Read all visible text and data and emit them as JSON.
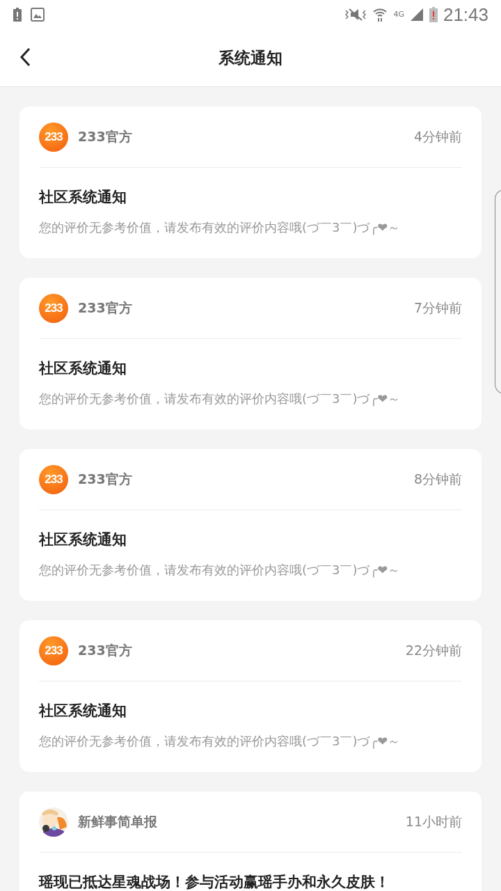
{
  "status_bar": {
    "time": "21:43",
    "network": "4G"
  },
  "header": {
    "title": "系统通知"
  },
  "notifications": [
    {
      "avatar": {
        "kind": "logo",
        "text": "233"
      },
      "sender": "233官方",
      "time": "4分钟前",
      "title": "社区系统通知",
      "body": "您的评价无参考价值，请发布有效的评价内容哦(づ￣3￣)づ╭❤～"
    },
    {
      "avatar": {
        "kind": "logo",
        "text": "233"
      },
      "sender": "233官方",
      "time": "7分钟前",
      "title": "社区系统通知",
      "body": "您的评价无参考价值，请发布有效的评价内容哦(づ￣3￣)づ╭❤～"
    },
    {
      "avatar": {
        "kind": "logo",
        "text": "233"
      },
      "sender": "233官方",
      "time": "8分钟前",
      "title": "社区系统通知",
      "body": "您的评价无参考价值，请发布有效的评价内容哦(づ￣3￣)づ╭❤～"
    },
    {
      "avatar": {
        "kind": "logo",
        "text": "233"
      },
      "sender": "233官方",
      "time": "22分钟前",
      "title": "社区系统通知",
      "body": "您的评价无参考价值，请发布有效的评价内容哦(づ￣3￣)づ╭❤～"
    },
    {
      "sender": "新鲜事简单报",
      "time": "11小时前",
      "title": "瑶现已抵达星魂战场！参与活动赢瑶手办和永久皮肤！"
    }
  ]
}
